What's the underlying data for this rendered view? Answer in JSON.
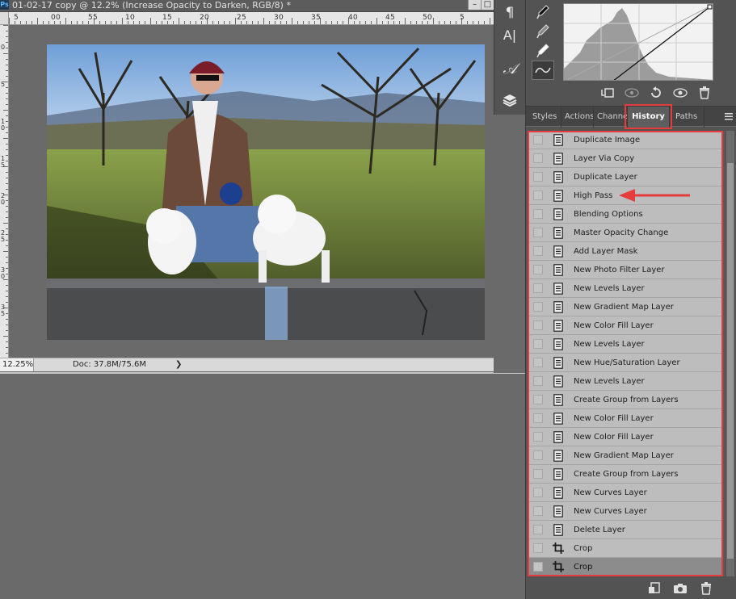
{
  "document": {
    "title": "01-02-17 copy @ 12.2% (Increase Opacity to Darken, RGB/8) *",
    "app_badge": "Ps",
    "window_buttons": [
      "–",
      "□"
    ],
    "zoom": "12.25%",
    "doc_info": "Doc: 37.8M/75.6M",
    "status_arrow": "❯",
    "ruler_h": [
      "5",
      "0",
      "5",
      "1",
      "1",
      "2",
      "2",
      "3",
      "3",
      "4",
      "4",
      "5",
      "5"
    ],
    "ruler_h_after": [
      "0",
      "5",
      "0",
      "5",
      "0",
      "5",
      "0",
      "5",
      "0",
      "5",
      "0"
    ],
    "ruler_v": [
      "0",
      "5",
      "1 0",
      "1 5",
      "2 0",
      "2 5",
      "3 0",
      "3 5"
    ]
  },
  "tool_strip": {
    "tools": [
      {
        "name": "paragraph-icon",
        "glyph": "¶"
      },
      {
        "name": "character-icon",
        "glyph": "A|"
      },
      {
        "name": "glyphs-icon",
        "glyph": "𝒜"
      },
      {
        "name": "layers-icon",
        "glyph": ""
      }
    ]
  },
  "panel_tabs": [
    {
      "label": "Styles",
      "active": false
    },
    {
      "label": "Actions",
      "active": false
    },
    {
      "label": "Channels",
      "active": false
    },
    {
      "label": "History",
      "active": true
    },
    {
      "label": "Paths",
      "active": false
    }
  ],
  "history": {
    "items": [
      {
        "label": "Duplicate Image",
        "icon": "document-icon",
        "selected": false
      },
      {
        "label": "Layer Via Copy",
        "icon": "document-icon",
        "selected": false
      },
      {
        "label": "Duplicate Layer",
        "icon": "document-icon",
        "selected": false
      },
      {
        "label": "High Pass",
        "icon": "document-icon",
        "selected": false
      },
      {
        "label": "Blending Options",
        "icon": "document-icon",
        "selected": false
      },
      {
        "label": "Master Opacity Change",
        "icon": "document-icon",
        "selected": false
      },
      {
        "label": "Add Layer Mask",
        "icon": "document-icon",
        "selected": false
      },
      {
        "label": "New Photo Filter Layer",
        "icon": "document-icon",
        "selected": false
      },
      {
        "label": "New Levels Layer",
        "icon": "document-icon",
        "selected": false
      },
      {
        "label": "New Gradient Map Layer",
        "icon": "document-icon",
        "selected": false
      },
      {
        "label": "New Color Fill Layer",
        "icon": "document-icon",
        "selected": false
      },
      {
        "label": "New Levels Layer",
        "icon": "document-icon",
        "selected": false
      },
      {
        "label": "New Hue/Saturation Layer",
        "icon": "document-icon",
        "selected": false
      },
      {
        "label": "New Levels Layer",
        "icon": "document-icon",
        "selected": false
      },
      {
        "label": "Create Group from Layers",
        "icon": "document-icon",
        "selected": false
      },
      {
        "label": "New Color Fill Layer",
        "icon": "document-icon",
        "selected": false
      },
      {
        "label": "New Color Fill Layer",
        "icon": "document-icon",
        "selected": false
      },
      {
        "label": "New Gradient Map Layer",
        "icon": "document-icon",
        "selected": false
      },
      {
        "label": "Create Group from Layers",
        "icon": "document-icon",
        "selected": false
      },
      {
        "label": "New Curves Layer",
        "icon": "document-icon",
        "selected": false
      },
      {
        "label": "New Curves Layer",
        "icon": "document-icon",
        "selected": false
      },
      {
        "label": "Delete Layer",
        "icon": "document-icon",
        "selected": false
      },
      {
        "label": "Crop",
        "icon": "crop-icon",
        "selected": false
      },
      {
        "label": "Crop",
        "icon": "crop-icon",
        "selected": true
      }
    ]
  },
  "colors": {
    "annotation_red": "#e53d3d",
    "panel_bg": "#535353",
    "row_bg": "#bdbdbd",
    "row_selected": "#8c8c8c"
  }
}
